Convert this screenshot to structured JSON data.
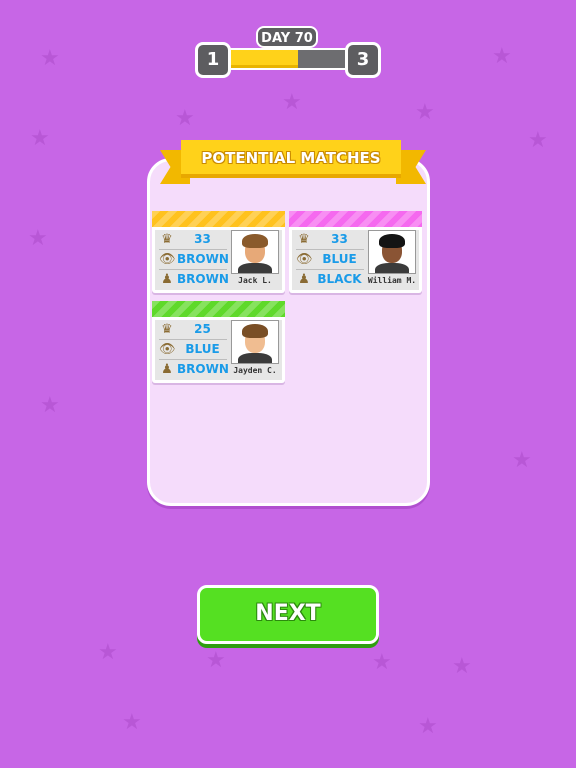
{
  "header": {
    "day_label": "DAY 70",
    "level_current": "1",
    "level_next": "3",
    "progress_fraction": 0.6
  },
  "panel": {
    "title": "POTENTIAL MATCHES"
  },
  "matches": [
    {
      "name": "Jack L.",
      "age": "33",
      "eyes": "BROWN",
      "hair": "BROWN",
      "strip_color": "#ffc21e",
      "hair_color": "#8a5a2b",
      "skin_color": "#e7a978"
    },
    {
      "name": "William M.",
      "age": "33",
      "eyes": "BLUE",
      "hair": "BLACK",
      "strip_color": "#f569ef",
      "hair_color": "#141414",
      "skin_color": "#8a5434"
    },
    {
      "name": "Jayden C.",
      "age": "25",
      "eyes": "BLUE",
      "hair": "BROWN",
      "strip_color": "#5fd92a",
      "hair_color": "#7a4f26",
      "skin_color": "#f0bd91"
    }
  ],
  "icons": {
    "age": "cake-icon",
    "eyes": "eye-icon",
    "hair": "hair-icon"
  },
  "buttons": {
    "next_label": "NEXT"
  },
  "colors": {
    "background": "#c766e6",
    "accent_green": "#55e022",
    "value_blue": "#1a9be8",
    "ribbon_yellow": "#ffd21a"
  }
}
